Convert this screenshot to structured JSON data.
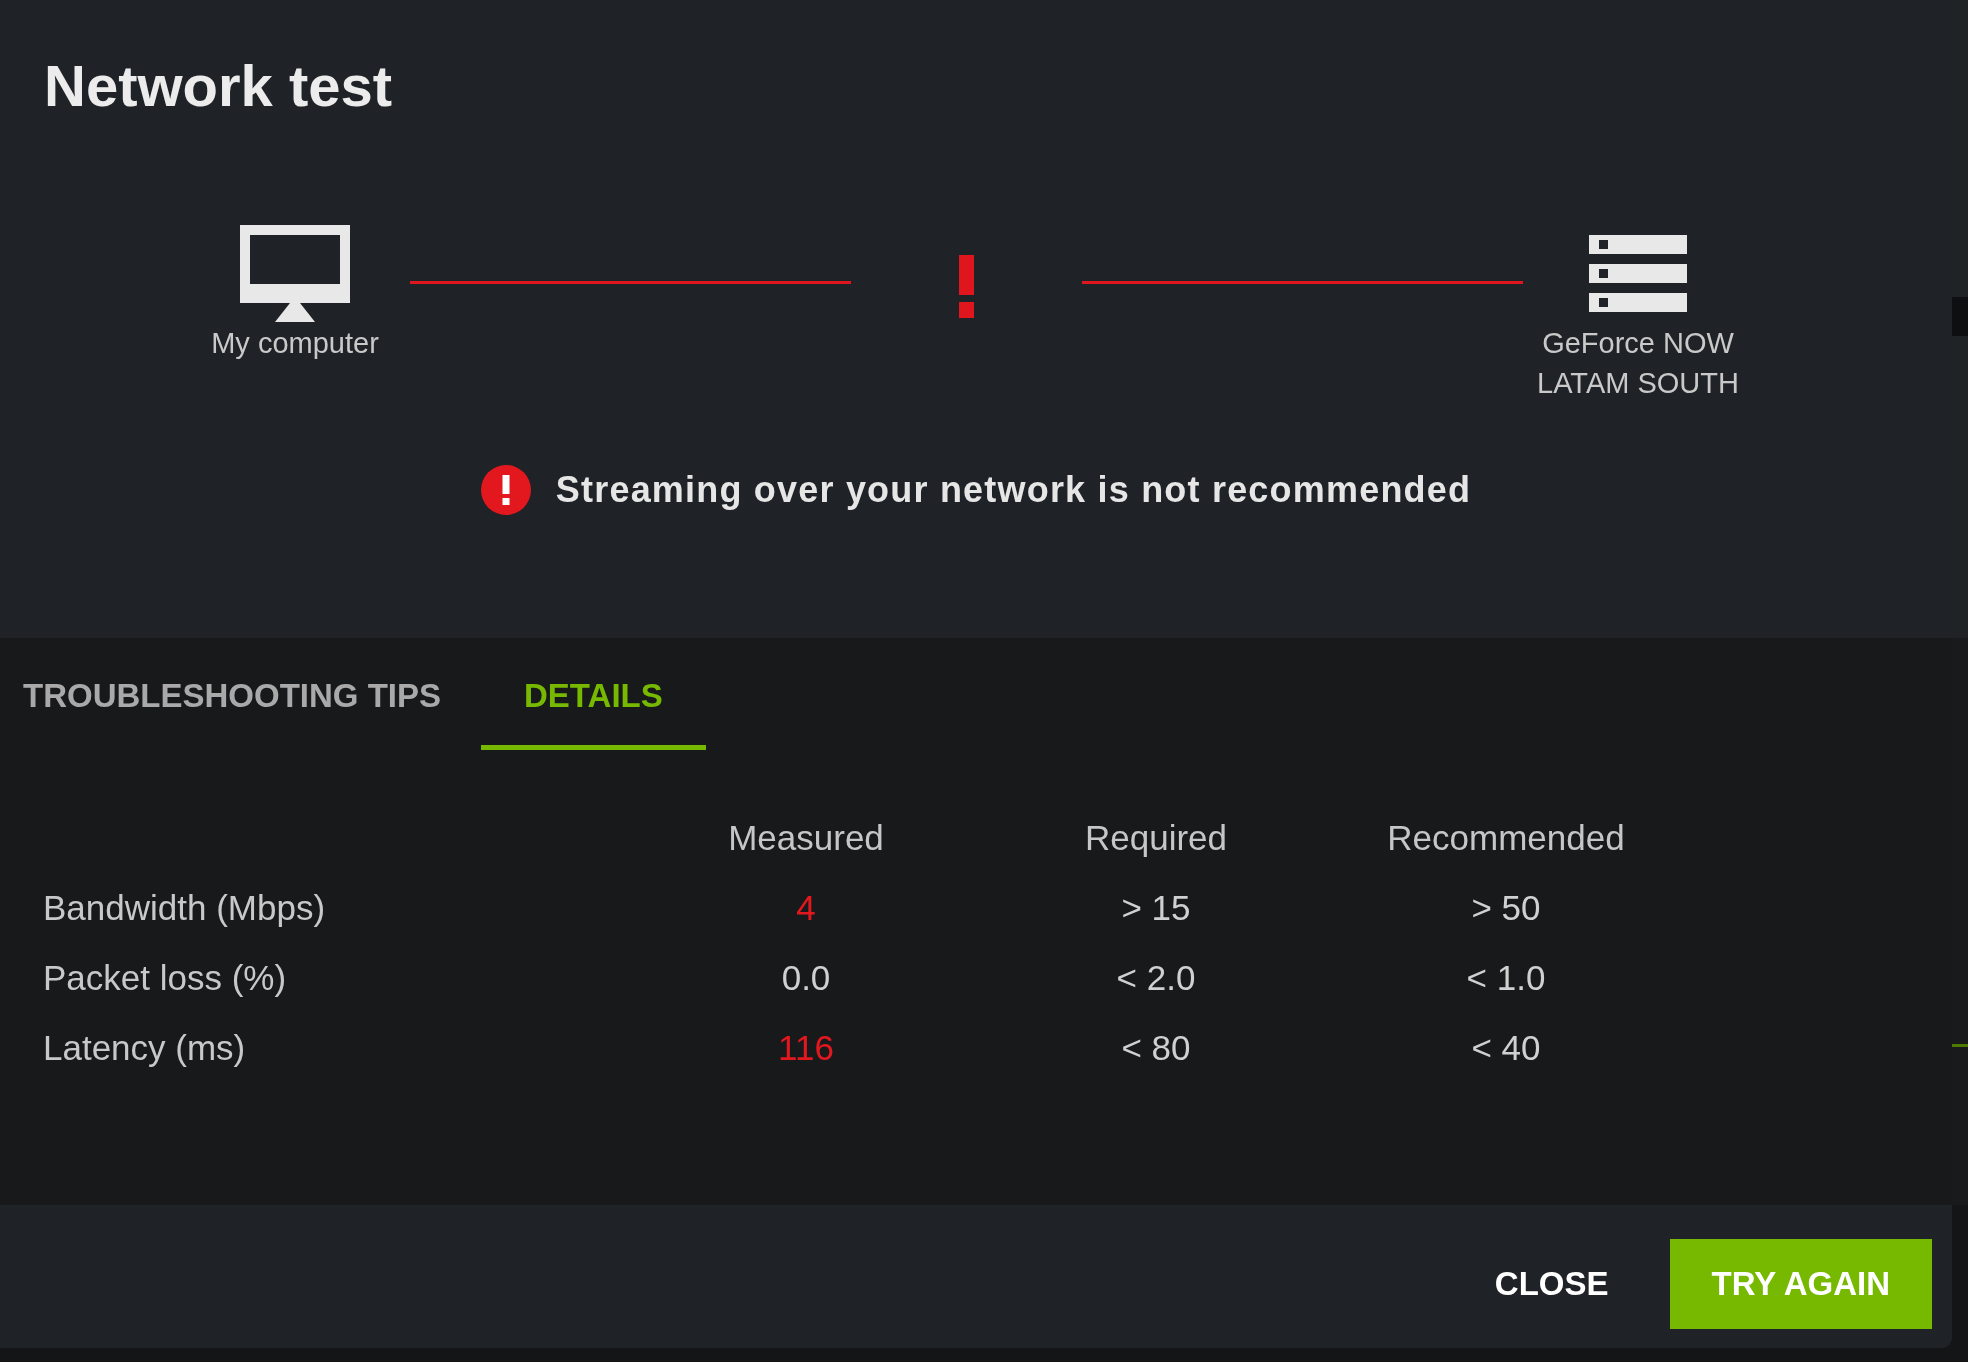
{
  "title": "Network test",
  "diagram": {
    "endpoints": [
      {
        "kind": "computer",
        "label": "My computer"
      },
      {
        "kind": "server",
        "label": "GeForce NOW LATAM SOUTH"
      }
    ],
    "connection": {
      "error": true
    }
  },
  "result": {
    "error": true,
    "message": "Streaming over your network is not recommended"
  },
  "tabs": [
    {
      "label": "TROUBLESHOOTING TIPS",
      "selected": false
    },
    {
      "label": "DETAILS",
      "selected": true
    }
  ],
  "details_table": {
    "columns": [
      "Measured",
      "Required",
      "Recommended"
    ],
    "rows": [
      {
        "metric": "Bandwidth (Mbps)",
        "measured": {
          "value": "4",
          "alert": true
        },
        "required": "> 15",
        "recommended": "> 50"
      },
      {
        "metric": "Packet loss (%)",
        "measured": {
          "value": "0.0",
          "alert": false
        },
        "required": "< 2.0",
        "recommended": "< 1.0"
      },
      {
        "metric": "Latency (ms)",
        "measured": {
          "value": "116",
          "alert": true
        },
        "required": "< 80",
        "recommended": "< 40"
      }
    ]
  },
  "buttons": [
    {
      "kind": "text",
      "label": "CLOSE"
    },
    {
      "kind": "primary",
      "label": "TRY AGAIN"
    }
  ]
}
